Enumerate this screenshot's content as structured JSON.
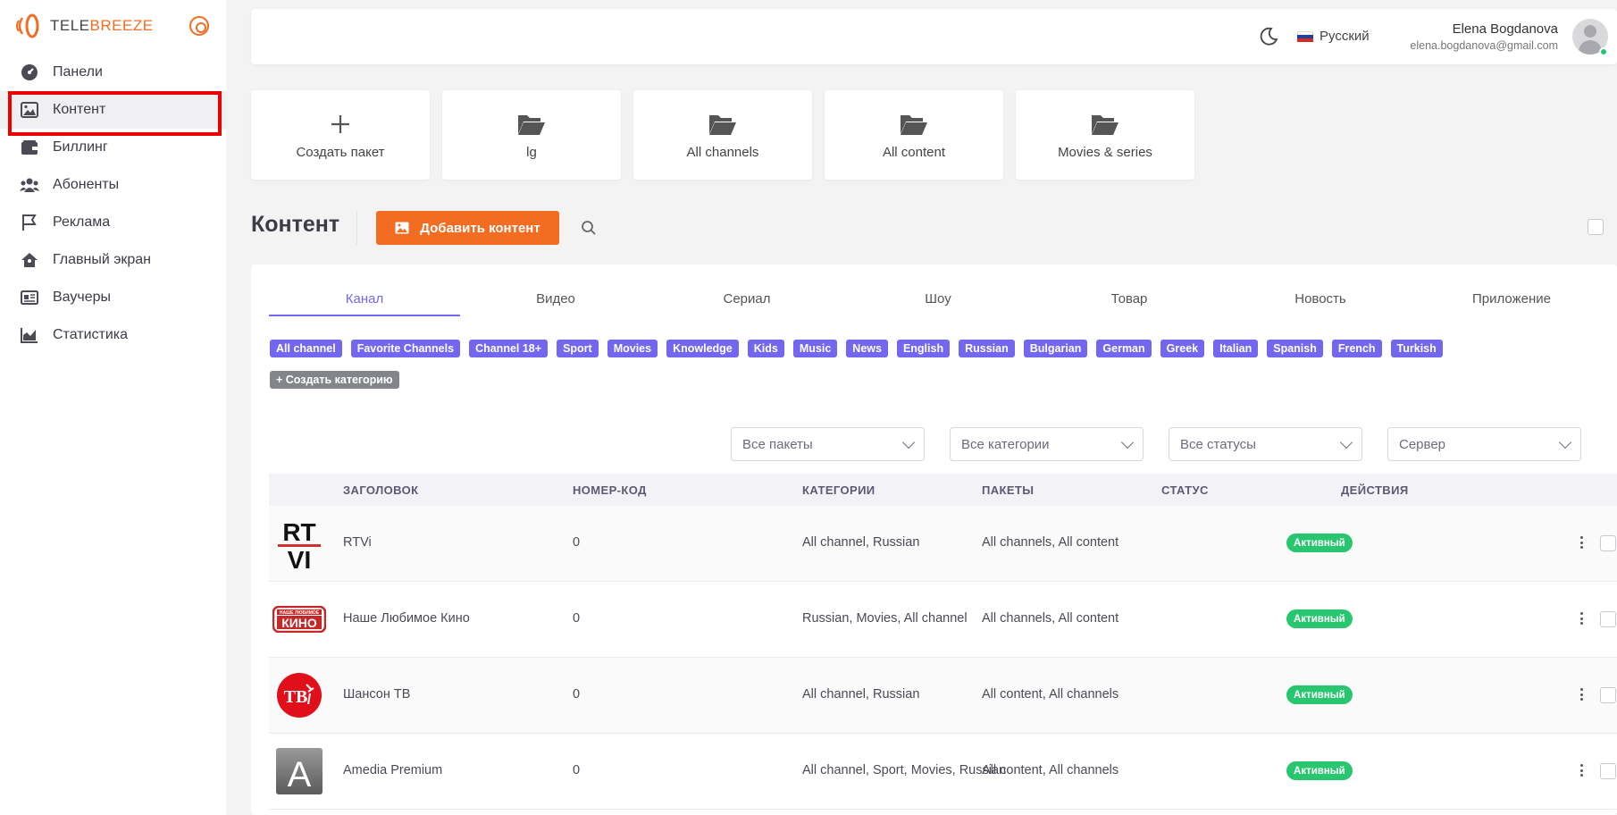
{
  "brand": {
    "name_a": "TELE",
    "name_b": "BREEZE",
    "accent": "#f26d21"
  },
  "sidebar": {
    "items": [
      {
        "label": "Панели",
        "icon": "dashboard-icon"
      },
      {
        "label": "Контент",
        "icon": "image-icon"
      },
      {
        "label": "Биллинг",
        "icon": "wallet-icon"
      },
      {
        "label": "Абоненты",
        "icon": "users-icon"
      },
      {
        "label": "Реклама",
        "icon": "flag-icon"
      },
      {
        "label": "Главный экран",
        "icon": "home-icon"
      },
      {
        "label": "Ваучеры",
        "icon": "voucher-icon"
      },
      {
        "label": "Статистика",
        "icon": "chart-icon"
      }
    ]
  },
  "topbar": {
    "language": "Русский",
    "user_name": "Elena Bogdanova",
    "user_email": "elena.bogdanova@gmail.com"
  },
  "packages": {
    "create_label": "Создать пакет",
    "items": [
      "lg",
      "All channels",
      "All content",
      "Movies & series"
    ]
  },
  "content": {
    "title": "Контент",
    "add_button": "Добавить контент"
  },
  "tabs": [
    "Канал",
    "Видео",
    "Сериал",
    "Шоу",
    "Товар",
    "Новость",
    "Приложение"
  ],
  "categories": [
    "All channel",
    "Favorite Channels",
    "Channel 18+",
    "Sport",
    "Movies",
    "Knowledge",
    "Kids",
    "Music",
    "News",
    "English",
    "Russian",
    "Bulgarian",
    "German",
    "Greek",
    "Italian",
    "Spanish",
    "French",
    "Turkish"
  ],
  "create_category": "+ Создать категорию",
  "filters": [
    "Все пакеты",
    "Все категории",
    "Все статусы",
    "Сервер"
  ],
  "table": {
    "headers": [
      "ЗАГОЛОВОК",
      "НОМЕР-КОД",
      "КАТЕГОРИИ",
      "ПАКЕТЫ",
      "СТАТУС",
      "ДЕЙСТВИЯ"
    ],
    "rows": [
      {
        "title": "RTVi",
        "code": "0",
        "categories": "All channel, Russian",
        "packages": "All channels, All content",
        "status": "Активный",
        "logo": "rtvi-logo"
      },
      {
        "title": "Наше Любимое Кино",
        "code": "0",
        "categories": "Russian, Movies, All channel",
        "packages": "All channels, All content",
        "status": "Активный",
        "logo": "nashe-kino-logo"
      },
      {
        "title": "Шансон ТВ",
        "code": "0",
        "categories": "All channel, Russian",
        "packages": "All content, All channels",
        "status": "Активный",
        "logo": "shanson-tv-logo"
      },
      {
        "title": "Amedia Premium",
        "code": "0",
        "categories": "All channel, Sport, Movies, Russian",
        "packages": "All content, All channels",
        "status": "Активный",
        "logo": "amedia-logo"
      }
    ]
  },
  "logo_text": {
    "rtvi_top": "RT",
    "rtvi_bottom": "VI",
    "kino": "КИНО",
    "kino_small": "НАШЕ ЛЮБИМОЕ",
    "tv": "ТВ",
    "amedia": "A"
  }
}
